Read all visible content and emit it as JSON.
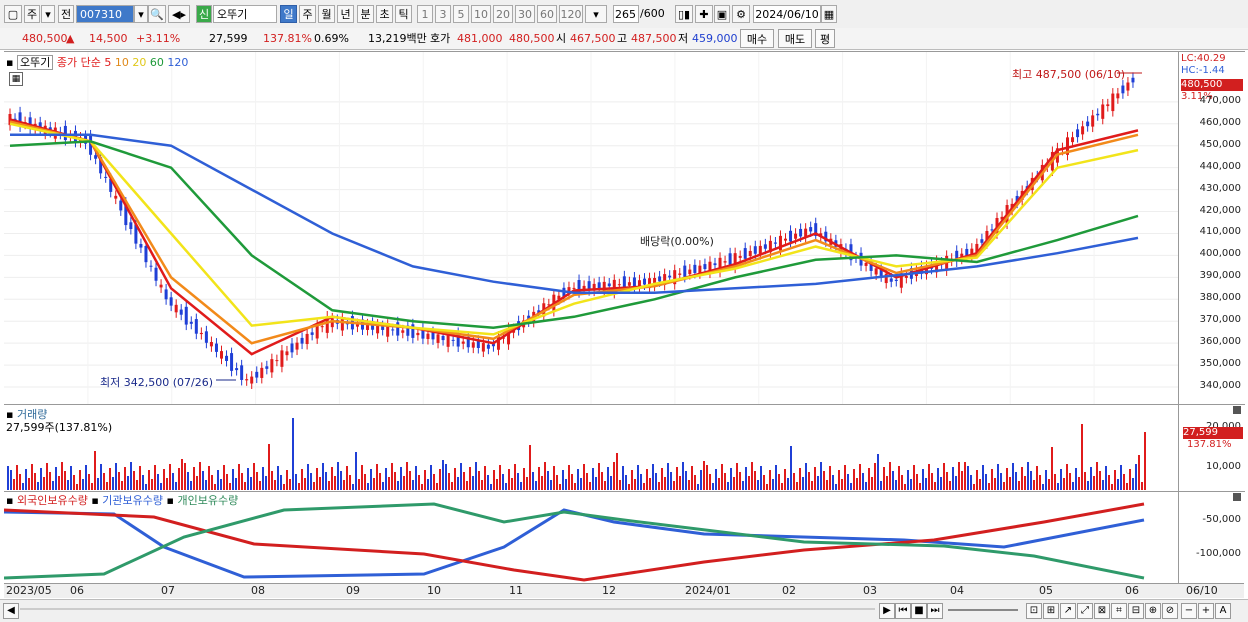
{
  "toolbar": {
    "market": "주",
    "prev": "전",
    "code": "007310",
    "name_badge": "신",
    "stock_name": "오뚜기",
    "periods": [
      "일",
      "주",
      "월",
      "년",
      "분",
      "초",
      "틱"
    ],
    "intervals": [
      "1",
      "3",
      "5",
      "10",
      "20",
      "30",
      "60",
      "120"
    ],
    "count": "265",
    "count_total": "/600",
    "date": "2024/06/10"
  },
  "quote": {
    "price": "480,500",
    "change": "14,500",
    "change_pct": "+3.11%",
    "volume": "27,599",
    "volume_ratio": "137.81%",
    "turnover": "0.69%",
    "amount": "13,219백만",
    "bid_label": "호가",
    "bid": "481,000",
    "ask": "480,500",
    "open_label": "시",
    "open": "467,500",
    "high_label": "고",
    "high": "487,500",
    "low_label": "저",
    "low": "459,000",
    "buy_label": "매수",
    "sell_label": "매도",
    "avg_label": "평"
  },
  "colors": {
    "up": "#e01b1b",
    "down": "#1f3fd6",
    "ma5": "#e01b1b",
    "ma10": "#f28a1a",
    "ma20": "#f2e41a",
    "ma60": "#1f9a3a",
    "ma120": "#2f5fd6",
    "foreign": "#2f5fd6",
    "inst": "#d21f1f",
    "retail": "#2f9a6a"
  },
  "price_panel": {
    "legend_name": "오뚜기",
    "legend_type": "종가 단순",
    "ma_labels": [
      "5",
      "10",
      "20",
      "60",
      "120"
    ],
    "lc": "LC:40.29",
    "hc": "HC:-1.44",
    "high_note": "최고 487,500 (06/10)",
    "low_note": "최저 342,500 (07/26)",
    "dividend_note": "배당락(0.00%)",
    "last_price": "480,500",
    "last_pct": "3.11%",
    "ticks": [
      "470,000",
      "460,000",
      "450,000",
      "440,000",
      "430,000",
      "420,000",
      "410,000",
      "400,000",
      "390,000",
      "380,000",
      "370,000",
      "360,000",
      "350,000",
      "340,000"
    ]
  },
  "volume_panel": {
    "title": "거래량",
    "info": "27,599주(137.81%)",
    "ticks": [
      "20,000",
      "10,000"
    ],
    "last": "27,599",
    "last_pct": "137.81%"
  },
  "holding_panel": {
    "foreign_label": "외국인보유수량",
    "inst_label": "기관보유수량",
    "retail_label": "개인보유수량",
    "ticks": [
      "-50,000",
      "-100,000"
    ]
  },
  "date_axis": [
    "2023/05",
    "06",
    "07",
    "08",
    "09",
    "10",
    "11",
    "12",
    "2024/01",
    "02",
    "03",
    "04",
    "05",
    "06"
  ],
  "date_axis_end": "06/10",
  "chart_data": {
    "type": "line",
    "title": "오뚜기",
    "ylim": [
      335000,
      490000
    ],
    "close_points": {
      "x": [
        "2023/05",
        "06",
        "07",
        "07/26",
        "08",
        "09",
        "10",
        "11",
        "12",
        "2024/01",
        "02",
        "03",
        "04",
        "05",
        "06/10"
      ],
      "y": [
        463000,
        452000,
        380000,
        342500,
        370000,
        365000,
        358000,
        385000,
        388000,
        398000,
        412000,
        388000,
        402000,
        445000,
        480500
      ]
    },
    "ma": [
      {
        "name": "5",
        "values": [
          462000,
          452000,
          385000,
          355000,
          372000,
          367000,
          360000,
          384000,
          386000,
          396000,
          410000,
          390000,
          401000,
          448000,
          457000
        ]
      },
      {
        "name": "10",
        "values": [
          461000,
          452000,
          390000,
          360000,
          370000,
          367000,
          362000,
          382000,
          386000,
          395000,
          407000,
          392000,
          400000,
          446000,
          455000
        ]
      },
      {
        "name": "20",
        "values": [
          460000,
          452000,
          410000,
          368000,
          372000,
          367000,
          364000,
          378000,
          387000,
          394000,
          404000,
          395000,
          399000,
          440000,
          448000
        ]
      },
      {
        "name": "60",
        "values": [
          450000,
          452000,
          440000,
          400000,
          375000,
          370000,
          367000,
          372000,
          380000,
          390000,
          398000,
          400000,
          397000,
          407000,
          418000
        ]
      },
      {
        "name": "120",
        "values": [
          455000,
          455000,
          450000,
          430000,
          410000,
          395000,
          388000,
          383000,
          383000,
          385000,
          387000,
          391000,
          395000,
          401000,
          408000
        ]
      }
    ]
  }
}
